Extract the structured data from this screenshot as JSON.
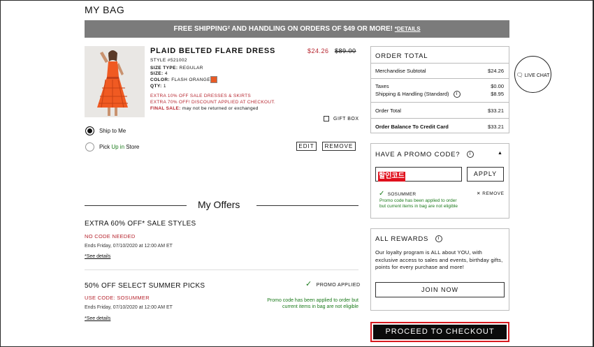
{
  "page": {
    "title": "MY BAG"
  },
  "banner": {
    "text": "FREE SHIPPING² AND HANDLING ON ORDERS OF $49 OR MORE! ",
    "details": "*DETAILS"
  },
  "product": {
    "name": "PLAID BELTED FLARE DRESS",
    "price_sale": "$24.26",
    "price_original": "$89.00",
    "style": "STYLE #521002",
    "size_type_label": "SIZE TYPE:",
    "size_type": "REGULAR",
    "size_label": "SIZE:",
    "size": "4",
    "color_label": "COLOR:",
    "color": "FLASH ORANGE",
    "qty_label": "QTY:",
    "qty": "1",
    "promo_line1": "EXTRA 10% OFF SALE DRESSES & SKIRTS",
    "promo_line2": "EXTRA 70% OFF! DISCOUNT APPLIED AT CHECKOUT.",
    "final_sale_label": "FINAL SALE:",
    "final_sale_text": " may not be returned or exchanged",
    "swatch_color": "#e85a25",
    "gift_box": "GIFT BOX",
    "edit": "EDIT",
    "remove": "REMOVE"
  },
  "shipping": {
    "ship_to_me": "Ship to Me",
    "pick_up_prefix": "Pick ",
    "pick_up_green": "Up in",
    "pick_up_suffix": " Store"
  },
  "offers": {
    "heading": "My Offers",
    "items": [
      {
        "title": "EXTRA 60% OFF* SALE STYLES",
        "code": "NO CODE NEEDED",
        "ends": "Ends Friday, 07/10/2020 at 12:00 AM ET",
        "link": "*See details"
      },
      {
        "title": "50% OFF SELECT SUMMER PICKS",
        "code": "USE CODE: SOSUMMER",
        "ends": "Ends Friday, 07/10/2020 at 12:00 AM ET",
        "link": "*See details",
        "status": "PROMO APPLIED",
        "note_line1": "Promo code has been applied to order but",
        "note_line2": "current items in bag are not eligible"
      }
    ]
  },
  "order_total": {
    "title": "ORDER TOTAL",
    "rows": [
      {
        "label": "Merchandise Subtotal",
        "value": "$24.26"
      },
      {
        "label": "Taxes",
        "value": "$0.00"
      },
      {
        "label": "Shipping & Handling (Standard)",
        "value": "$8.95"
      },
      {
        "label": "Order Total",
        "value": "$33.21"
      },
      {
        "label": "Order Balance To Credit Card",
        "value": "$33.21"
      }
    ]
  },
  "live_chat": {
    "label": "LIVE CHAT"
  },
  "promo": {
    "title": "HAVE A PROMO CODE?",
    "input_value": "할인코드",
    "apply": "APPLY",
    "applied_code": "SOSUMMER",
    "remove": "REMOVE",
    "note_line1": "Promo code has been applied to order",
    "note_line2": "but current items in bag are not eligible"
  },
  "rewards": {
    "title": "ALL REWARDS",
    "text": "Our loyalty program is ALL about YOU, with exclusive access to sales and events, birthday gifts, points for every purchase and more!",
    "join": "JOIN NOW"
  },
  "checkout": {
    "label": "PROCEED TO CHECKOUT"
  },
  "colors": {
    "accent_red": "#b6242e",
    "banner_gray": "#7b7b7b",
    "success_green": "#1a7a1a",
    "checkout_border": "#d71a1f"
  }
}
